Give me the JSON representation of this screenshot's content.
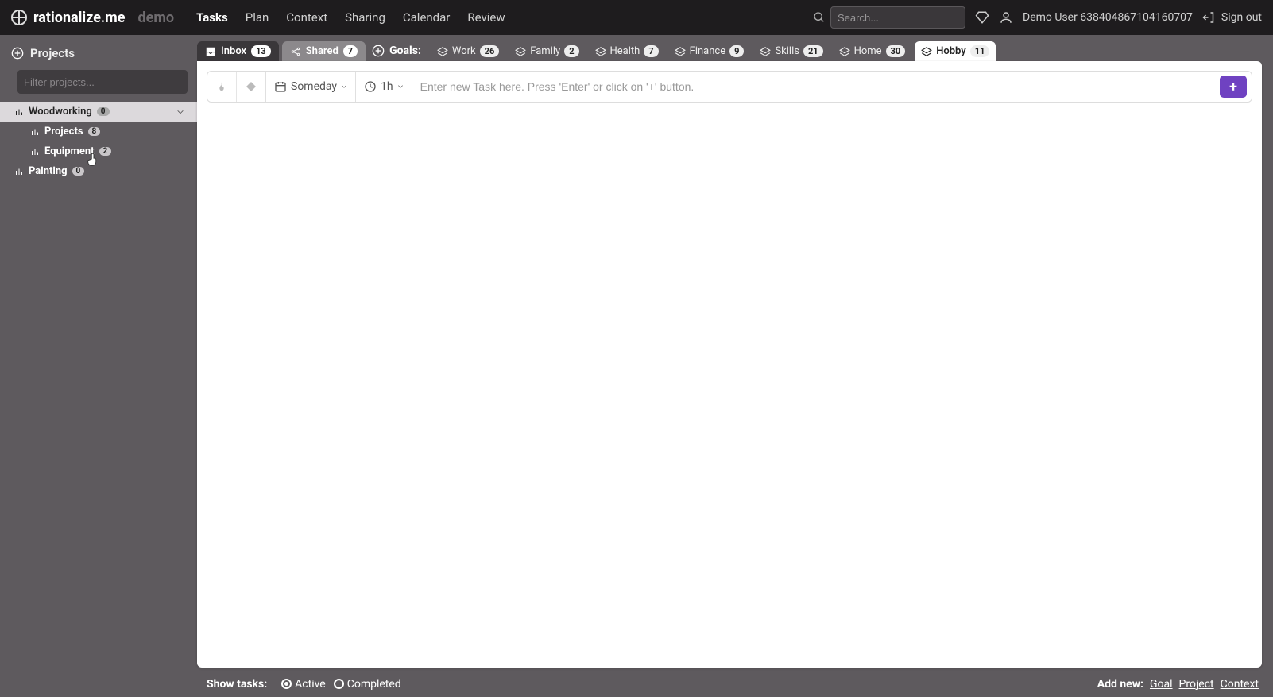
{
  "brand": "rationalize.me",
  "demo_tag": "demo",
  "nav": [
    "Tasks",
    "Plan",
    "Context",
    "Sharing",
    "Calendar",
    "Review"
  ],
  "nav_active": "Tasks",
  "search_placeholder": "Search...",
  "username": "Demo User 638404867104160707",
  "signout": "Sign out",
  "sidebar": {
    "heading": "Projects",
    "filter_placeholder": "Filter projects...",
    "items": [
      {
        "label": "Woodworking",
        "count": "0",
        "selected": true,
        "expandable": true
      },
      {
        "label": "Projects",
        "count": "8",
        "child": true
      },
      {
        "label": "Equipment",
        "count": "2",
        "child": true
      },
      {
        "label": "Painting",
        "count": "0",
        "child": false
      }
    ]
  },
  "tabs": {
    "inbox": {
      "label": "Inbox",
      "count": "13"
    },
    "shared": {
      "label": "Shared",
      "count": "7"
    },
    "goals_label": "Goals:",
    "goals": [
      {
        "label": "Work",
        "count": "26"
      },
      {
        "label": "Family",
        "count": "2"
      },
      {
        "label": "Health",
        "count": "7"
      },
      {
        "label": "Finance",
        "count": "9"
      },
      {
        "label": "Skills",
        "count": "21"
      },
      {
        "label": "Home",
        "count": "30"
      },
      {
        "label": "Hobby",
        "count": "11",
        "active": true
      }
    ]
  },
  "task_input": {
    "someday": "Someday",
    "duration": "1h",
    "placeholder": "Enter new Task here. Press 'Enter' or click on '+' button.",
    "add_label": "+"
  },
  "footer": {
    "show_tasks": "Show tasks:",
    "active": "Active",
    "completed": "Completed",
    "add_new": "Add new:",
    "links": [
      "Goal",
      "Project",
      "Context"
    ]
  }
}
